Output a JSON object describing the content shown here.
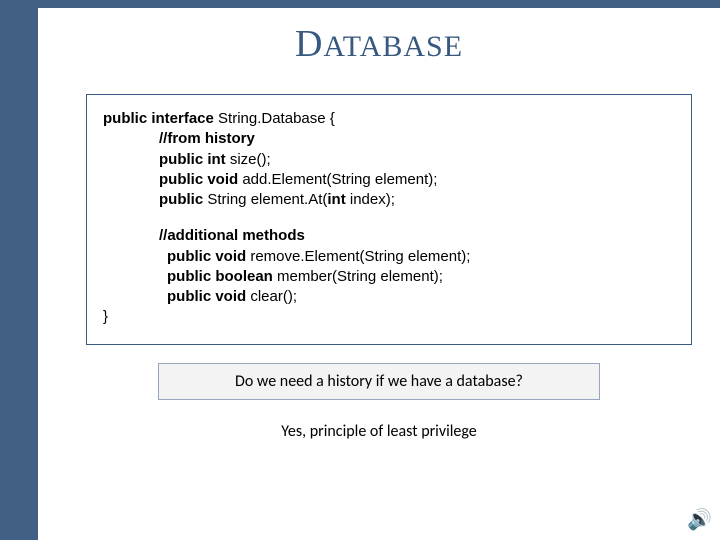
{
  "title": {
    "firstLetter": "D",
    "rest": "ATABASE"
  },
  "code": {
    "decl_kw": "public interface",
    "decl_name": "  String.Database {",
    "comment1": "//from history",
    "l1_kw": "public int",
    "l1_rest": " size();",
    "l2_kw": "public void",
    "l2_rest": " add.Element(String element);",
    "l3_kw1": "public",
    "l3_mid": " String element.At(",
    "l3_kw2": "int",
    "l3_rest": " index);",
    "comment2": "//additional methods",
    "a1_kw": "public void",
    "a1_rest": " remove.Element(String element);",
    "a2_kw": "public boolean",
    "a2_rest": " member(String element);",
    "a3_kw": "public void",
    "a3_rest": " clear();",
    "close": "}"
  },
  "callout": "Do we need a history if we have a database?",
  "answer": "Yes, principle of least privilege"
}
